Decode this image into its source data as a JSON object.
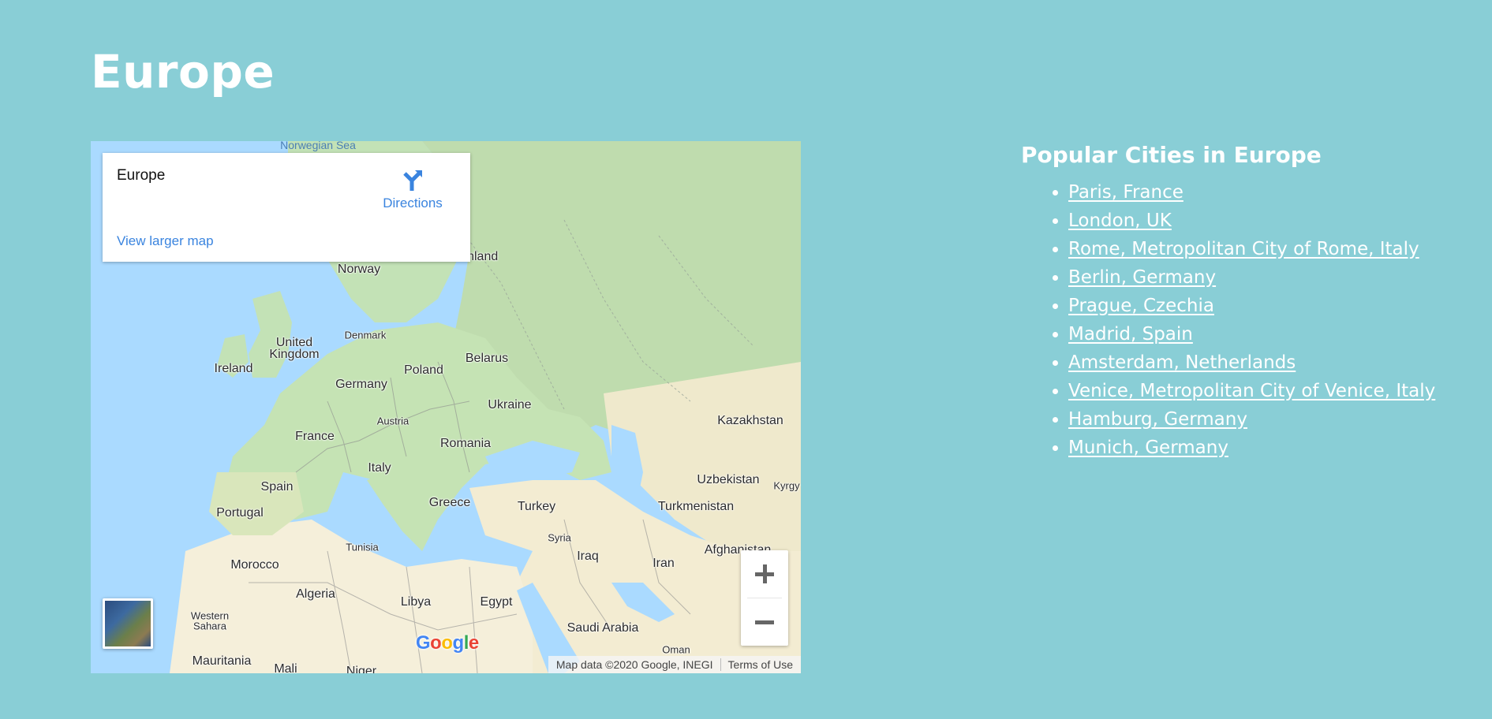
{
  "page": {
    "title": "Europe"
  },
  "map": {
    "place_card": {
      "name": "Europe",
      "directions_label": "Directions",
      "view_larger_label": "View larger map"
    },
    "labels": {
      "norwegian_sea": "Norwegian Sea",
      "finland": "Finland",
      "norway": "Norway",
      "united_kingdom_1": "United",
      "united_kingdom_2": "Kingdom",
      "denmark": "Denmark",
      "ireland": "Ireland",
      "belarus": "Belarus",
      "poland": "Poland",
      "germany": "Germany",
      "ukraine": "Ukraine",
      "austria": "Austria",
      "kazakhstan": "Kazakhstan",
      "france": "France",
      "romania": "Romania",
      "italy": "Italy",
      "uzbekistan": "Uzbekistan",
      "spain": "Spain",
      "kyrgyz": "Kyrgy",
      "greece": "Greece",
      "turkey": "Turkey",
      "turkmenistan": "Turkmenistan",
      "portugal": "Portugal",
      "tunisia": "Tunisia",
      "syria": "Syria",
      "afghanistan": "Afghanistan",
      "iraq": "Iraq",
      "morocco": "Morocco",
      "iran": "Iran",
      "algeria": "Algeria",
      "libya": "Libya",
      "egypt": "Egypt",
      "western_sahara_1": "Western",
      "western_sahara_2": "Sahara",
      "saudi_arabia": "Saudi Arabia",
      "oman": "Oman",
      "mauritania": "Mauritania",
      "mali": "Mali",
      "niger": "Niger"
    },
    "google_logo": "Google",
    "attribution": "Map data ©2020 Google, INEGI",
    "terms_label": "Terms of Use",
    "zoom_in_label": "+",
    "zoom_out_label": "−"
  },
  "cities": {
    "heading": "Popular Cities in Europe",
    "items": [
      "Paris, France",
      "London, UK",
      "Rome, Metropolitan City of Rome, Italy",
      "Berlin, Germany",
      "Prague, Czechia",
      "Madrid, Spain",
      "Amsterdam, Netherlands",
      "Venice, Metropolitan City of Venice, Italy",
      "Hamburg, Germany",
      "Munich, Germany"
    ]
  },
  "colors": {
    "background": "#89ced6",
    "water": "#aadaff",
    "land": "#b9ddb0",
    "desert": "#f5efda",
    "link_blue": "#3a84df"
  }
}
